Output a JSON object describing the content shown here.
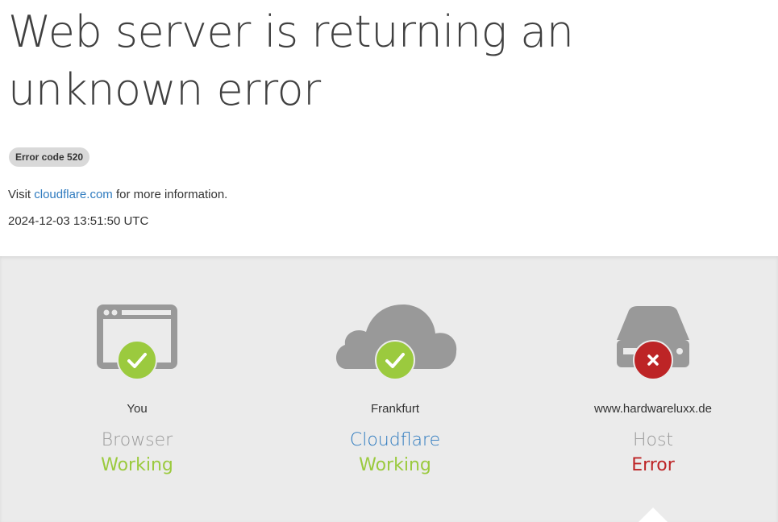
{
  "page": {
    "title": "Web server is returning an unknown error",
    "error_badge": "Error code 520",
    "info_prefix": "Visit ",
    "info_link": "cloudflare.com",
    "info_suffix": " for more information.",
    "timestamp": "2024-12-03 13:51:50 UTC"
  },
  "colors": {
    "working": "#9bca3e",
    "error": "#bd2426",
    "icon_gray": "#999999",
    "link": "#2f7bbf"
  },
  "status": [
    {
      "location": "You",
      "service": "Browser",
      "state": "Working",
      "icon": "browser-window-icon",
      "badge_icon": "checkmark-icon"
    },
    {
      "location": "Frankfurt",
      "service": "Cloudflare",
      "state": "Working",
      "icon": "cloud-icon",
      "badge_icon": "checkmark-icon"
    },
    {
      "location": "www.hardwareluxx.de",
      "service": "Host",
      "state": "Error",
      "icon": "server-drive-icon",
      "badge_icon": "x-icon"
    }
  ]
}
